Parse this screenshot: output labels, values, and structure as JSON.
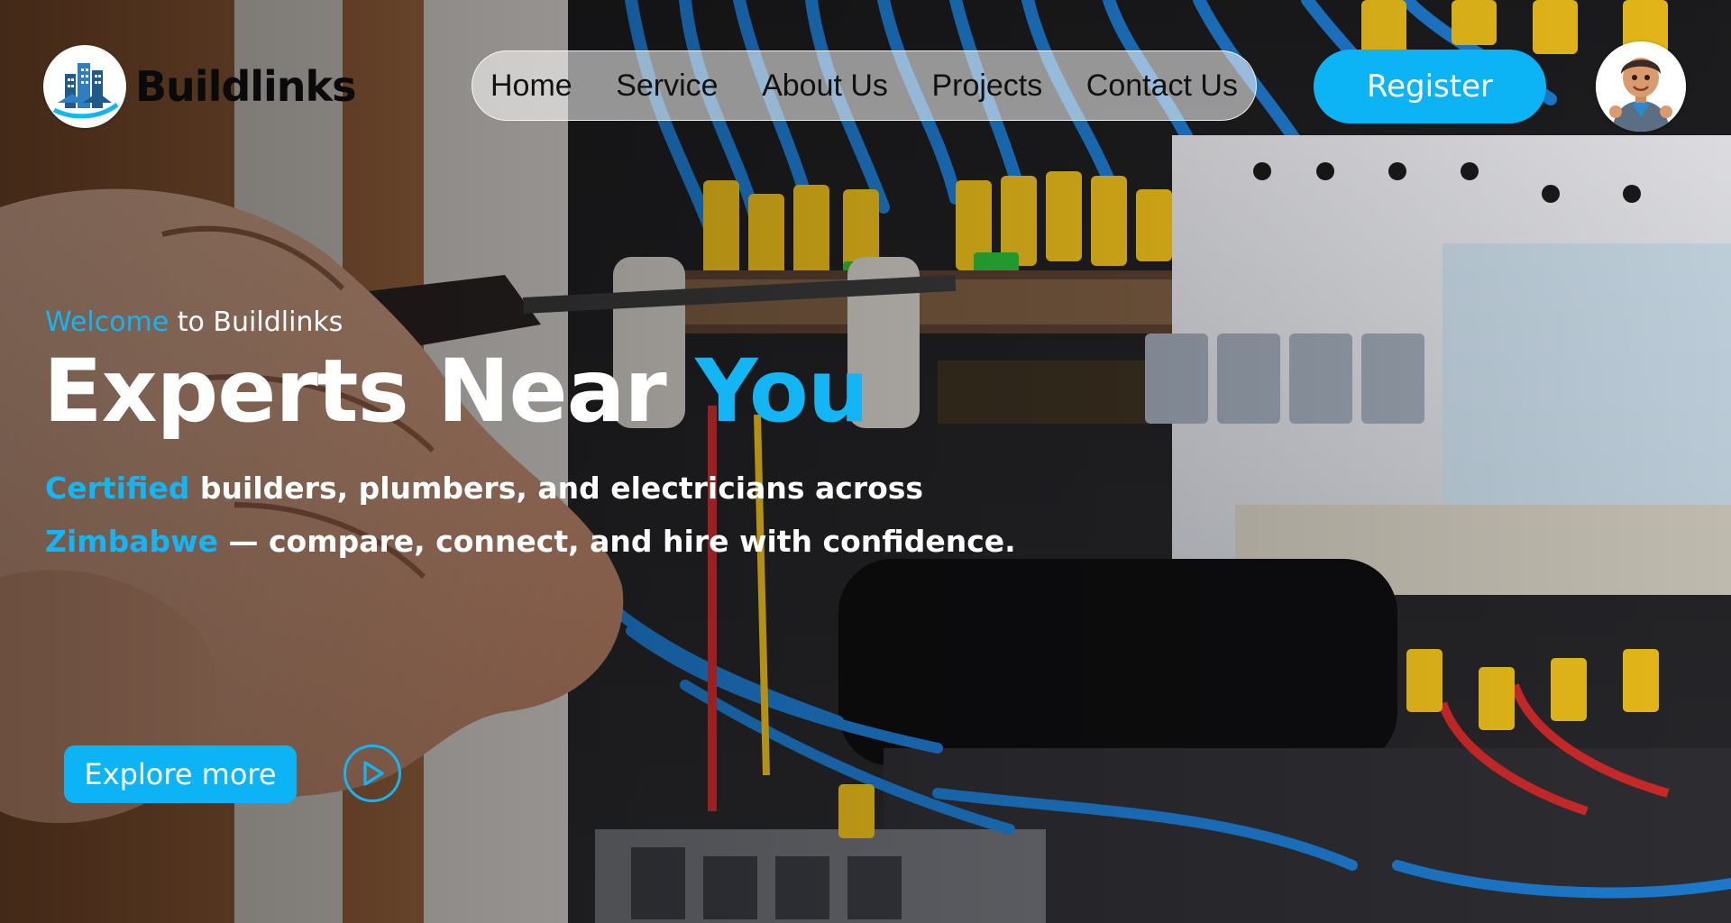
{
  "brand": {
    "name": "Buildlinks",
    "logo_icon": "buildings-logo-icon"
  },
  "nav": {
    "items": [
      {
        "label": "Home"
      },
      {
        "label": "Service"
      },
      {
        "label": "About Us"
      },
      {
        "label": "Projects"
      },
      {
        "label": "Contact Us"
      }
    ]
  },
  "header": {
    "register_label": "Register",
    "avatar_icon": "user-avatar-icon"
  },
  "hero": {
    "welcome_accent": "Welcome",
    "welcome_rest": " to Buildlinks",
    "headline_main": "Experts Near ",
    "headline_accent": "You",
    "sub_accent_1": "Certified",
    "sub_part_1": " builders, plumbers, and electricians across ",
    "sub_accent_2": "Zimbabwe",
    "sub_part_2": " — compare, connect, and hire with confidence.",
    "explore_label": "Explore more",
    "play_icon": "play-icon"
  },
  "colors": {
    "accent": "#13b5f4",
    "button": "#0db4f5",
    "text_dark": "#111111",
    "text_light": "#ffffff"
  }
}
